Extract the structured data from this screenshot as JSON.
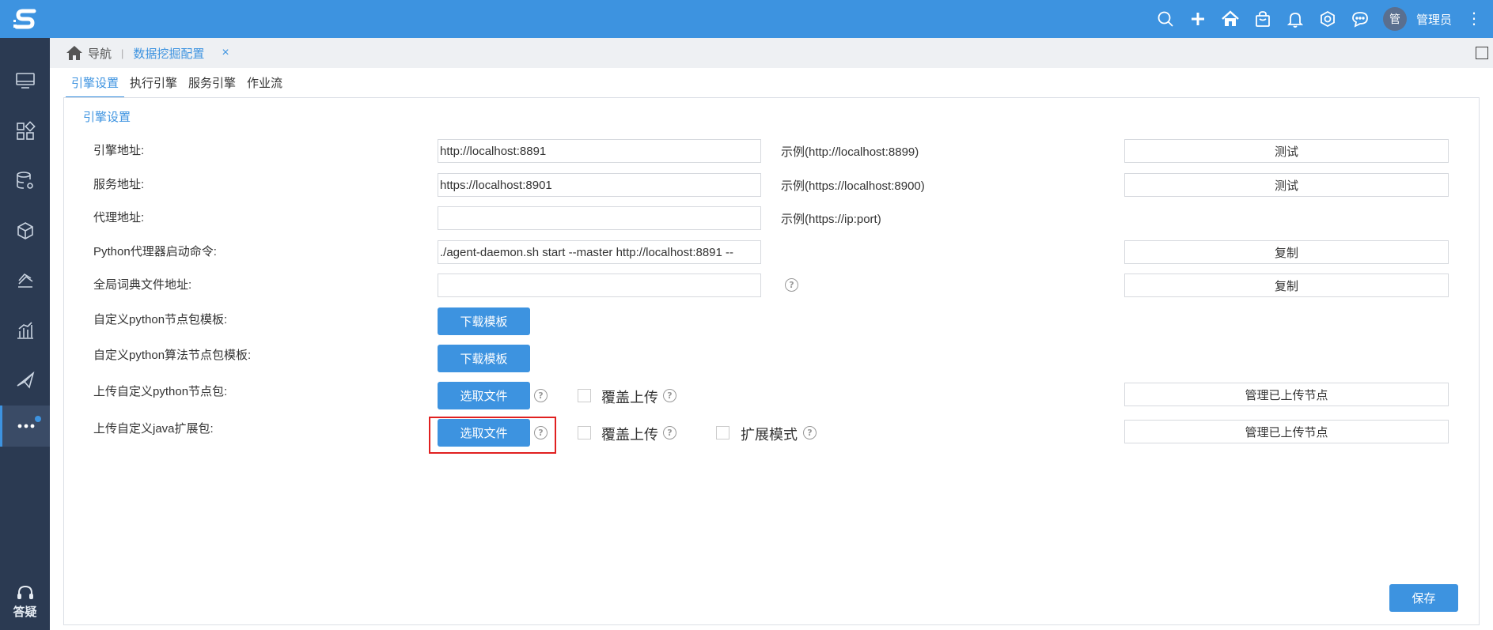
{
  "header": {
    "user_avatar_text": "管",
    "username": "管理员",
    "more_glyph": "⋮"
  },
  "sidebar": {
    "help_label": "答疑"
  },
  "breadcrumb": {
    "nav_label": "导航",
    "separator": "|",
    "current_tab": "数据挖掘配置",
    "close_glyph": "×"
  },
  "tabs": [
    {
      "label": "引擎设置",
      "active": true
    },
    {
      "label": "执行引擎",
      "active": false
    },
    {
      "label": "服务引擎",
      "active": false
    },
    {
      "label": "作业流",
      "active": false
    }
  ],
  "panel": {
    "title": "引擎设置"
  },
  "form": {
    "engine_address": {
      "label": "引擎地址:",
      "value": "http://localhost:8891",
      "example": "示例(http://localhost:8899)",
      "button": "测试"
    },
    "service_address": {
      "label": "服务地址:",
      "value": "https://localhost:8901",
      "example": "示例(https://localhost:8900)",
      "button": "测试"
    },
    "proxy_address": {
      "label": "代理地址:",
      "value": "",
      "example": "示例(https://ip:port)"
    },
    "python_proxy_cmd": {
      "label": "Python代理器启动命令:",
      "value": "./agent-daemon.sh start --master http://localhost:8891 --",
      "button": "复制"
    },
    "global_dict": {
      "label": "全局词典文件地址:",
      "value": "",
      "button": "复制"
    },
    "python_node_template": {
      "label": "自定义python节点包模板:",
      "button": "下载模板"
    },
    "python_algo_template": {
      "label": "自定义python算法节点包模板:",
      "button": "下载模板"
    },
    "upload_python": {
      "label": "上传自定义python节点包:",
      "button": "选取文件",
      "overwrite_label": "覆盖上传",
      "manage_button": "管理已上传节点"
    },
    "upload_java": {
      "label": "上传自定义java扩展包:",
      "button": "选取文件",
      "overwrite_label": "覆盖上传",
      "extend_label": "扩展模式",
      "manage_button": "管理已上传节点"
    }
  },
  "help_glyph": "?",
  "save_button": "保存",
  "colors": {
    "accent": "#3d93e0",
    "sidebar": "#2b3a52",
    "highlight": "#e02020"
  }
}
